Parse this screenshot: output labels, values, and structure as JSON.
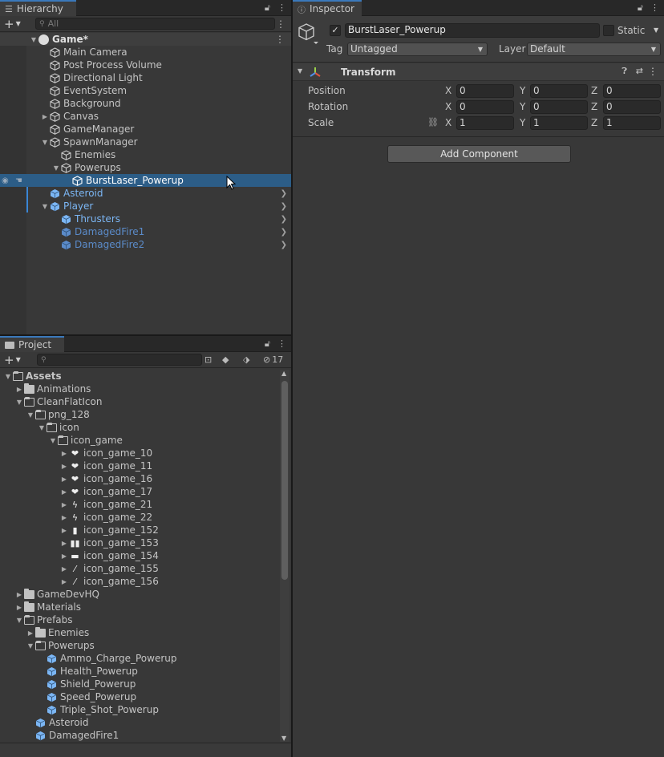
{
  "hierarchy": {
    "tab_label": "Hierarchy",
    "search_placeholder": "All",
    "scene_name": "Game*",
    "items": [
      {
        "label": "Main Camera",
        "depth": 1,
        "arrow": "",
        "style": "normal"
      },
      {
        "label": "Post Process Volume",
        "depth": 1,
        "arrow": "",
        "style": "normal"
      },
      {
        "label": "Directional Light",
        "depth": 1,
        "arrow": "",
        "style": "normal"
      },
      {
        "label": "EventSystem",
        "depth": 1,
        "arrow": "",
        "style": "normal"
      },
      {
        "label": "Background",
        "depth": 1,
        "arrow": "",
        "style": "normal"
      },
      {
        "label": "Canvas",
        "depth": 1,
        "arrow": "right",
        "style": "normal"
      },
      {
        "label": "GameManager",
        "depth": 1,
        "arrow": "",
        "style": "normal"
      },
      {
        "label": "SpawnManager",
        "depth": 1,
        "arrow": "down",
        "style": "normal"
      },
      {
        "label": "Enemies",
        "depth": 2,
        "arrow": "",
        "style": "normal"
      },
      {
        "label": "Powerups",
        "depth": 2,
        "arrow": "down",
        "style": "normal"
      },
      {
        "label": "BurstLaser_Powerup",
        "depth": 3,
        "arrow": "",
        "style": "selected"
      },
      {
        "label": "Asteroid",
        "depth": 1,
        "arrow": "",
        "style": "prefab"
      },
      {
        "label": "Player",
        "depth": 1,
        "arrow": "down",
        "style": "prefab"
      },
      {
        "label": "Thrusters",
        "depth": 2,
        "arrow": "",
        "style": "prefab"
      },
      {
        "label": "DamagedFire1",
        "depth": 2,
        "arrow": "",
        "style": "prefab-inactive"
      },
      {
        "label": "DamagedFire2",
        "depth": 2,
        "arrow": "",
        "style": "prefab-inactive"
      }
    ]
  },
  "project": {
    "tab_label": "Project",
    "hidden_count": "17",
    "items": [
      {
        "label": "Assets",
        "depth": 0,
        "arrow": "down",
        "kind": "folder-open",
        "bold": true
      },
      {
        "label": "Animations",
        "depth": 1,
        "arrow": "right",
        "kind": "folder"
      },
      {
        "label": "CleanFlatIcon",
        "depth": 1,
        "arrow": "down",
        "kind": "folder-open"
      },
      {
        "label": "png_128",
        "depth": 2,
        "arrow": "down",
        "kind": "folder-open"
      },
      {
        "label": "icon",
        "depth": 3,
        "arrow": "down",
        "kind": "folder-open"
      },
      {
        "label": "icon_game",
        "depth": 4,
        "arrow": "down",
        "kind": "folder-open"
      },
      {
        "label": "icon_game_10",
        "depth": 5,
        "arrow": "right",
        "kind": "glyph",
        "glyph": "❤"
      },
      {
        "label": "icon_game_11",
        "depth": 5,
        "arrow": "right",
        "kind": "glyph",
        "glyph": "❤"
      },
      {
        "label": "icon_game_16",
        "depth": 5,
        "arrow": "right",
        "kind": "glyph",
        "glyph": "❤"
      },
      {
        "label": "icon_game_17",
        "depth": 5,
        "arrow": "right",
        "kind": "glyph",
        "glyph": "❤"
      },
      {
        "label": "icon_game_21",
        "depth": 5,
        "arrow": "right",
        "kind": "glyph",
        "glyph": "ϟ"
      },
      {
        "label": "icon_game_22",
        "depth": 5,
        "arrow": "right",
        "kind": "glyph",
        "glyph": "ϟ"
      },
      {
        "label": "icon_game_152",
        "depth": 5,
        "arrow": "right",
        "kind": "glyph",
        "glyph": "▮"
      },
      {
        "label": "icon_game_153",
        "depth": 5,
        "arrow": "right",
        "kind": "glyph",
        "glyph": "▮▮"
      },
      {
        "label": "icon_game_154",
        "depth": 5,
        "arrow": "right",
        "kind": "glyph",
        "glyph": "▬"
      },
      {
        "label": "icon_game_155",
        "depth": 5,
        "arrow": "right",
        "kind": "glyph",
        "glyph": "⁄"
      },
      {
        "label": "icon_game_156",
        "depth": 5,
        "arrow": "right",
        "kind": "glyph",
        "glyph": "⁄"
      },
      {
        "label": "GameDevHQ",
        "depth": 1,
        "arrow": "right",
        "kind": "folder"
      },
      {
        "label": "Materials",
        "depth": 1,
        "arrow": "right",
        "kind": "folder"
      },
      {
        "label": "Prefabs",
        "depth": 1,
        "arrow": "down",
        "kind": "folder-open"
      },
      {
        "label": "Enemies",
        "depth": 2,
        "arrow": "right",
        "kind": "folder"
      },
      {
        "label": "Powerups",
        "depth": 2,
        "arrow": "down",
        "kind": "folder-open"
      },
      {
        "label": "Ammo_Charge_Powerup",
        "depth": 3,
        "arrow": "",
        "kind": "prefab"
      },
      {
        "label": "Health_Powerup",
        "depth": 3,
        "arrow": "",
        "kind": "prefab"
      },
      {
        "label": "Shield_Powerup",
        "depth": 3,
        "arrow": "",
        "kind": "prefab"
      },
      {
        "label": "Speed_Powerup",
        "depth": 3,
        "arrow": "",
        "kind": "prefab"
      },
      {
        "label": "Triple_Shot_Powerup",
        "depth": 3,
        "arrow": "",
        "kind": "prefab"
      },
      {
        "label": "Asteroid",
        "depth": 2,
        "arrow": "",
        "kind": "prefab"
      },
      {
        "label": "DamagedFire1",
        "depth": 2,
        "arrow": "",
        "kind": "prefab"
      }
    ]
  },
  "inspector": {
    "tab_label": "Inspector",
    "object_name": "BurstLaser_Powerup",
    "static_label": "Static",
    "tag_label": "Tag",
    "tag_value": "Untagged",
    "layer_label": "Layer",
    "layer_value": "Default",
    "component_title": "Transform",
    "rows": [
      {
        "label": "Position",
        "x": "0",
        "y": "0",
        "z": "0"
      },
      {
        "label": "Rotation",
        "x": "0",
        "y": "0",
        "z": "0"
      },
      {
        "label": "Scale",
        "x": "1",
        "y": "1",
        "z": "1"
      }
    ],
    "axis_x": "X",
    "axis_y": "Y",
    "axis_z": "Z",
    "add_component_label": "Add Component"
  },
  "colors": {
    "selection": "#2c5d87",
    "prefab_blue": "#7bb6f4",
    "tab_accent": "#3a79bb"
  }
}
